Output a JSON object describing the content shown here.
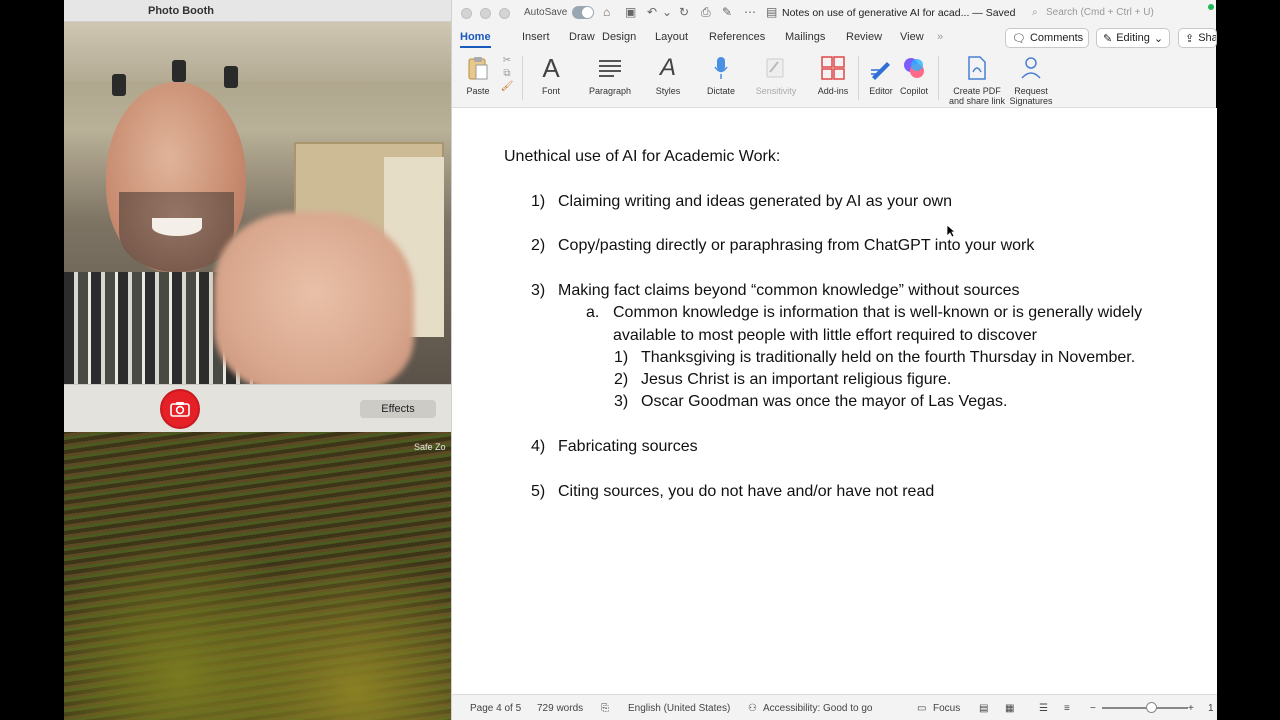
{
  "photobooth": {
    "title": "Photo Booth",
    "effects_label": "Effects"
  },
  "desktop": {
    "safe_zone_label": "Safe Zo"
  },
  "word": {
    "autosave_label": "AutoSave",
    "doc_title": "Notes on use of generative AI for acad... — Saved",
    "search_placeholder": "Search (Cmd + Ctrl + U)",
    "tabs": [
      "Home",
      "Insert",
      "Draw",
      "Design",
      "Layout",
      "References",
      "Mailings",
      "Review",
      "View"
    ],
    "more_tabs": "»",
    "comments_label": "Comments",
    "editing_label": "Editing",
    "share_label": "Sha",
    "ribbon": {
      "paste": "Paste",
      "font": "Font",
      "paragraph": "Paragraph",
      "styles": "Styles",
      "dictate": "Dictate",
      "sensitivity": "Sensitivity",
      "addins": "Add-ins",
      "editor": "Editor",
      "copilot": "Copilot",
      "create_pdf_1": "Create PDF",
      "create_pdf_2": "and share link",
      "request_sig_1": "Request",
      "request_sig_2": "Signatures"
    },
    "document": {
      "heading": "Unethical use of AI for Academic Work:",
      "items": [
        {
          "num": "1)",
          "text": "Claiming writing and ideas generated by AI as your own"
        },
        {
          "num": "2)",
          "text": "Copy/pasting directly or paraphrasing from ChatGPT into your work"
        },
        {
          "num": "3)",
          "text": "Making fact claims beyond “common knowledge” without sources"
        },
        {
          "num": "4)",
          "text": "Fabricating sources"
        },
        {
          "num": "5)",
          "text": "Citing sources, you do not have and/or have not read"
        }
      ],
      "sub_item": {
        "num": "a.",
        "text_line1": "Common knowledge is information that is well-known or is generally widely",
        "text_line2": "available to most people with little effort required to discover"
      },
      "examples": [
        {
          "num": "1)",
          "text": "Thanksgiving is traditionally held on the fourth Thursday in November."
        },
        {
          "num": "2)",
          "text": "Jesus Christ is an important religious figure."
        },
        {
          "num": "3)",
          "text": "Oscar Goodman was once the mayor of Las Vegas."
        }
      ]
    },
    "status": {
      "page": "Page 4 of 5",
      "words": "729 words",
      "language": "English (United States)",
      "accessibility": "Accessibility: Good to go",
      "focus": "Focus",
      "zoom_partial": "1"
    },
    "colors": {
      "accent": "#185abd",
      "shutter": "#e52027"
    }
  }
}
